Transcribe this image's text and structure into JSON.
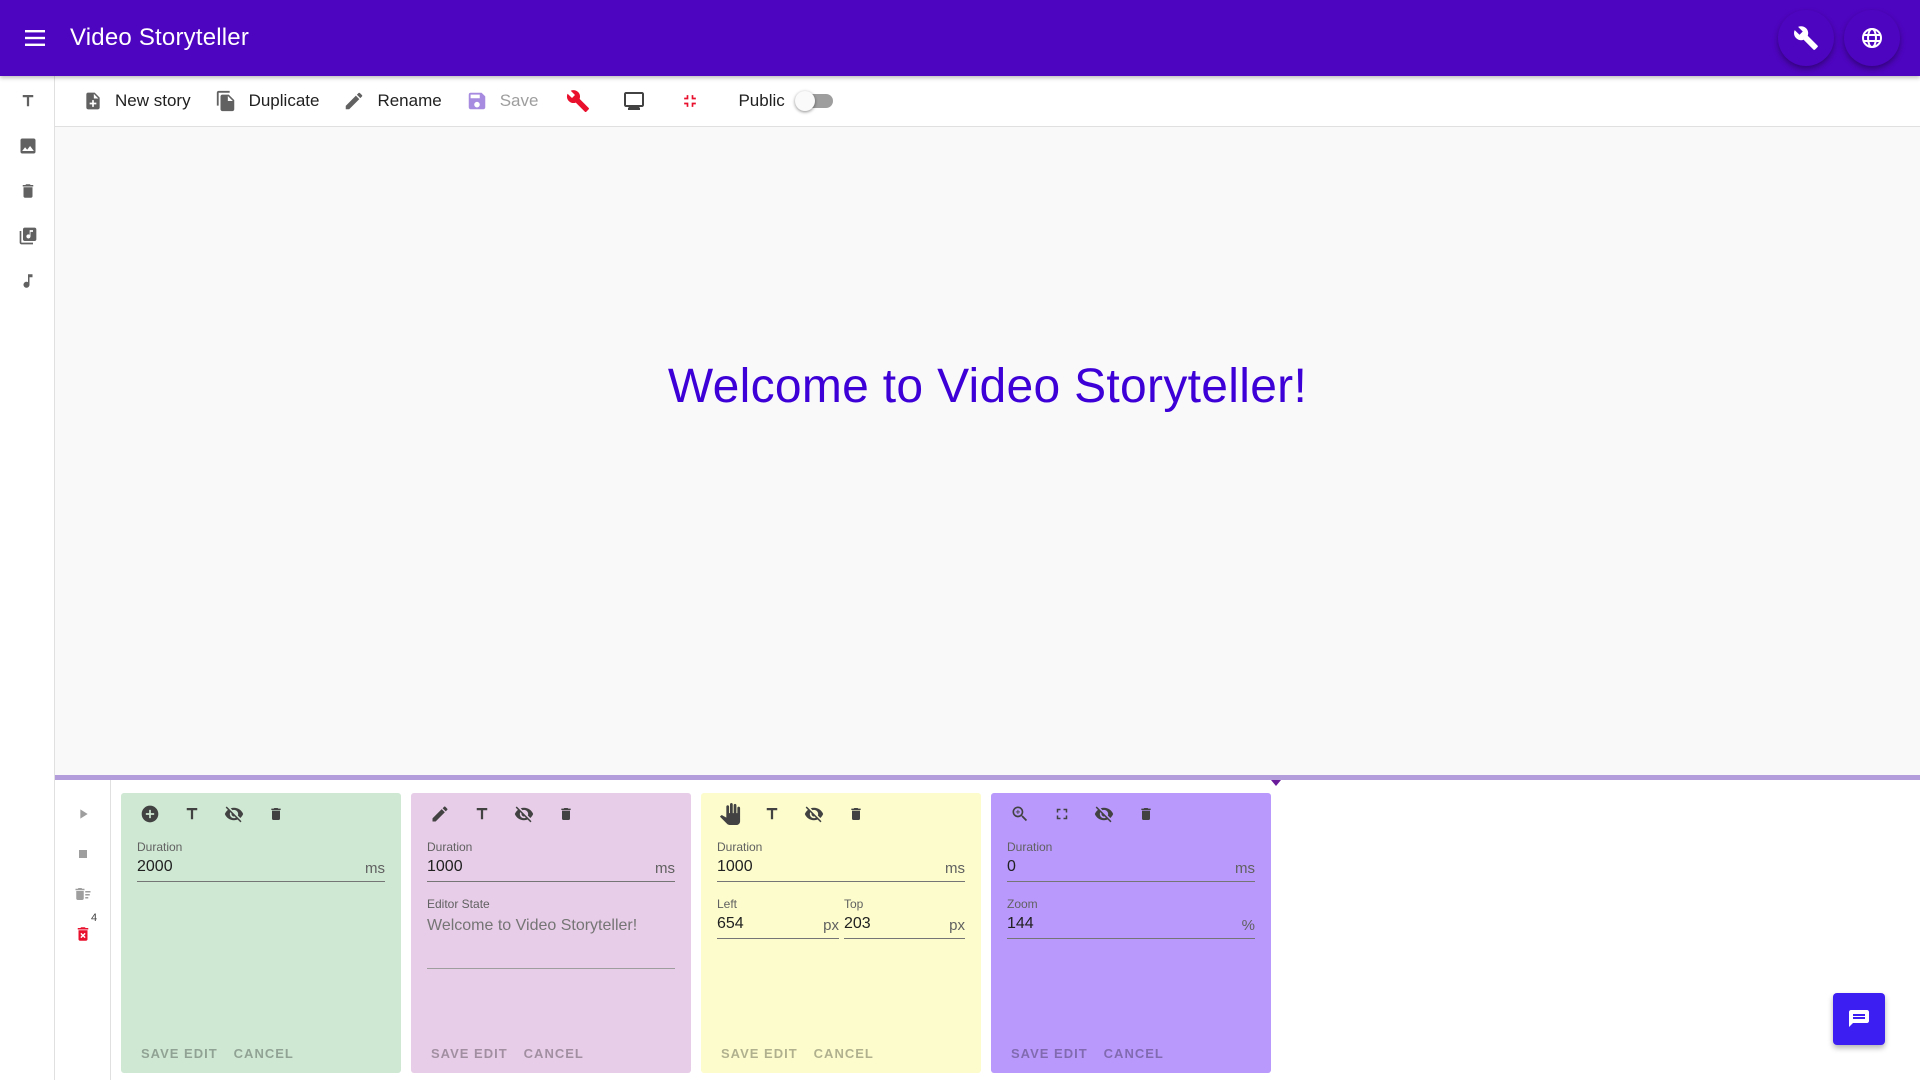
{
  "app": {
    "title": "Video Storyteller"
  },
  "colors": {
    "primary": "#4e05bf",
    "accent_red": "#e8102d",
    "welcome_text": "#3d00d6",
    "chat_fab": "#3d1ef2"
  },
  "header_icons": [
    "menu-icon",
    "wrench-icon",
    "globe-icon"
  ],
  "rail_icons": [
    "text-icon",
    "image-icon",
    "trash-icon",
    "library-music-icon",
    "music-note-icon"
  ],
  "toolbar": {
    "new_story": "New story",
    "duplicate": "Duplicate",
    "rename": "Rename",
    "save": "Save",
    "public_label": "Public",
    "public_on": false
  },
  "canvas": {
    "welcome_text": "Welcome to Video Storyteller!"
  },
  "timeline": {
    "delete_badge": "4",
    "cards": [
      {
        "color": "#cfe8d3",
        "type_icon": "add-circle-icon",
        "duration_label": "Duration",
        "duration": "2000",
        "duration_unit": "ms",
        "save_edit": "SAVE EDIT",
        "cancel": "CANCEL"
      },
      {
        "color": "#e7cde7",
        "type_icon": "pencil-icon",
        "duration_label": "Duration",
        "duration": "1000",
        "duration_unit": "ms",
        "editor_state_label": "Editor State",
        "editor_state": "Welcome to Video Storyteller!",
        "save_edit": "SAVE EDIT",
        "cancel": "CANCEL"
      },
      {
        "color": "#fcfccc",
        "type_icon": "hand-icon",
        "duration_label": "Duration",
        "duration": "1000",
        "duration_unit": "ms",
        "left_label": "Left",
        "left": "654",
        "left_unit": "px",
        "top_label": "Top",
        "top": "203",
        "top_unit": "px",
        "save_edit": "SAVE EDIT",
        "cancel": "CANCEL"
      },
      {
        "color": "#b999fc",
        "type_icon": "zoom-in-icon",
        "duration_label": "Duration",
        "duration": "0",
        "duration_unit": "ms",
        "zoom_label": "Zoom",
        "zoom": "144",
        "zoom_unit": "%",
        "save_edit": "SAVE EDIT",
        "cancel": "CANCEL"
      }
    ]
  }
}
